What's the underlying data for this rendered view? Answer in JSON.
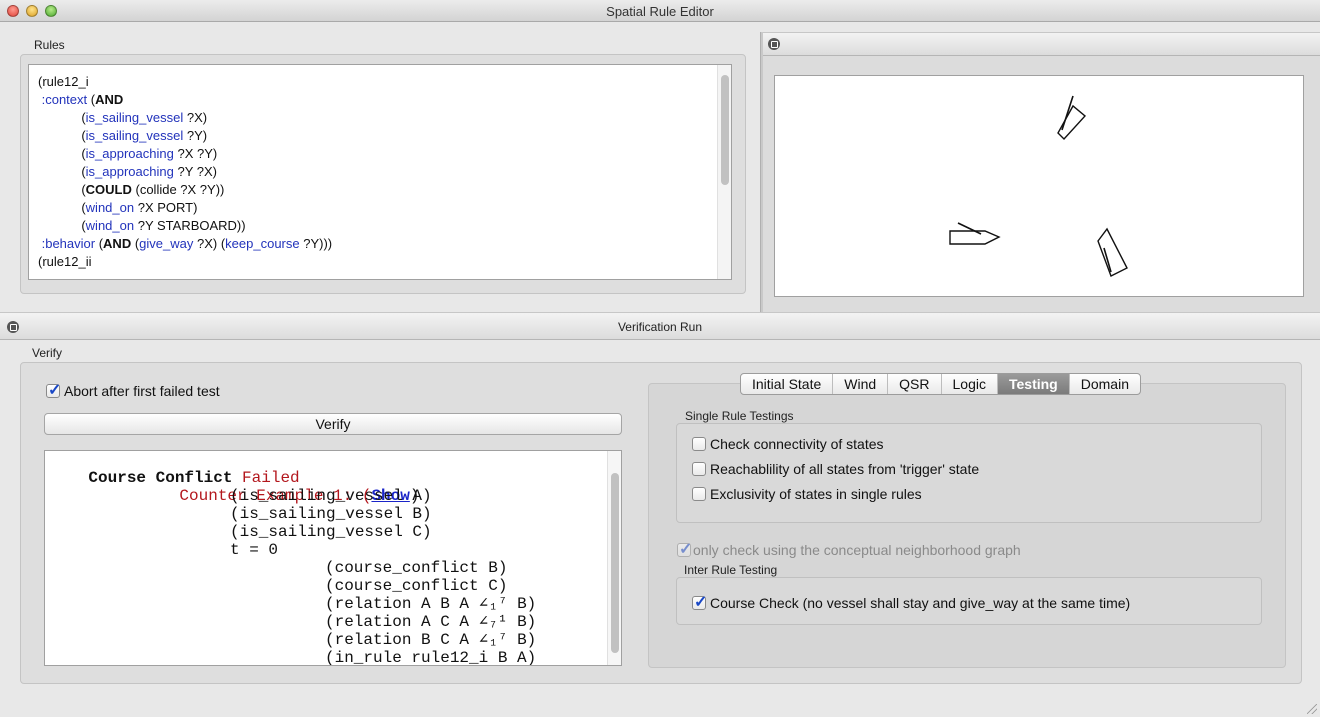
{
  "window": {
    "title": "Spatial Rule Editor"
  },
  "rules_pane": {
    "label": "Rules",
    "code": [
      {
        "parts": [
          {
            "t": "(rule12_i",
            "c": ""
          }
        ]
      },
      {
        "parts": [
          {
            "t": " :context",
            "c": "kw"
          },
          {
            "t": " (",
            "c": ""
          },
          {
            "t": "AND",
            "c": "b"
          }
        ]
      },
      {
        "parts": [
          {
            "t": "            (",
            "c": ""
          },
          {
            "t": "is_sailing_vessel",
            "c": "kw"
          },
          {
            "t": " ?X)",
            "c": ""
          }
        ]
      },
      {
        "parts": [
          {
            "t": "            (",
            "c": ""
          },
          {
            "t": "is_sailing_vessel",
            "c": "kw"
          },
          {
            "t": " ?Y)",
            "c": ""
          }
        ]
      },
      {
        "parts": [
          {
            "t": "            (",
            "c": ""
          },
          {
            "t": "is_approaching",
            "c": "kw"
          },
          {
            "t": " ?X ?Y)",
            "c": ""
          }
        ]
      },
      {
        "parts": [
          {
            "t": "            (",
            "c": ""
          },
          {
            "t": "is_approaching",
            "c": "kw"
          },
          {
            "t": " ?Y ?X)",
            "c": ""
          }
        ]
      },
      {
        "parts": [
          {
            "t": "            (",
            "c": ""
          },
          {
            "t": "COULD",
            "c": "b"
          },
          {
            "t": " (collide ?X ?Y))",
            "c": ""
          }
        ]
      },
      {
        "parts": [
          {
            "t": "            (",
            "c": ""
          },
          {
            "t": "wind_on",
            "c": "kw"
          },
          {
            "t": " ?X PORT)",
            "c": ""
          }
        ]
      },
      {
        "parts": [
          {
            "t": "            (",
            "c": ""
          },
          {
            "t": "wind_on",
            "c": "kw"
          },
          {
            "t": " ?Y STARBOARD))",
            "c": ""
          }
        ]
      },
      {
        "parts": [
          {
            "t": " :behavior",
            "c": "kw"
          },
          {
            "t": " (",
            "c": ""
          },
          {
            "t": "AND",
            "c": "b"
          },
          {
            "t": " (",
            "c": ""
          },
          {
            "t": "give_way",
            "c": "kw"
          },
          {
            "t": " ?X) (",
            "c": ""
          },
          {
            "t": "keep_course",
            "c": "kw"
          },
          {
            "t": " ?Y)))",
            "c": ""
          }
        ]
      },
      {
        "parts": [
          {
            "t": "(rule12_ii",
            "c": ""
          }
        ]
      }
    ]
  },
  "verification": {
    "header": "Verification Run",
    "group_label": "Verify",
    "abort_checkbox": {
      "label": "Abort after first failed test",
      "checked": true
    },
    "verify_button": "Verify",
    "output": {
      "test_name": "Course Conflict",
      "test_status": "Failed",
      "counter_example": "Counter Example 1: (",
      "show_link": "Show",
      "close_paren": ")",
      "lines": [
        "(is_sailing_vessel A)",
        "(is_sailing_vessel B)",
        "(is_sailing_vessel C)",
        "t = 0"
      ],
      "state_lines": [
        "(course_conflict B)",
        "(course_conflict C)",
        "(relation A B A ∠₁⁷ B)",
        "(relation A C A ∠₇¹ B)",
        "(relation B C A ∠₁⁷ B)",
        "(in_rule rule12_i B A)"
      ]
    }
  },
  "tabs": [
    "Initial State",
    "Wind",
    "QSR",
    "Logic",
    "Testing",
    "Domain"
  ],
  "active_tab": "Testing",
  "testing": {
    "single_title": "Single Rule Testings",
    "single_options": [
      {
        "label": "Check connectivity of states",
        "checked": false
      },
      {
        "label": "Reachablility of all states from 'trigger' state",
        "checked": false
      },
      {
        "label": "Exclusivity of states in single rules",
        "checked": false
      }
    ],
    "cng_option": {
      "label": "only check using the conceptual neighborhood graph",
      "checked": true,
      "disabled": true
    },
    "inter_title": "Inter Rule Testing",
    "inter_option": {
      "label": "Course Check (no vessel shall stay and give_way at the same time)",
      "checked": true
    }
  },
  "icons": [
    "detach-icon",
    "vessel-icon"
  ],
  "colors": {
    "keyword": "#2233bb",
    "failed": "#b3171d",
    "link": "#1a24c8",
    "check": "#1a48c6"
  }
}
